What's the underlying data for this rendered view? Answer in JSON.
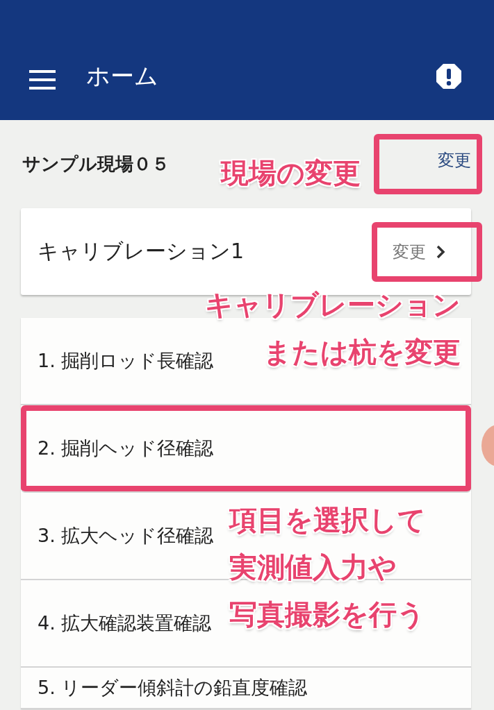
{
  "app_bar": {
    "title": "ホーム"
  },
  "site": {
    "name": "サンプル現場０５",
    "change_label": "変更"
  },
  "calibration": {
    "name": "キャリブレーション1",
    "change_label": "変更"
  },
  "items": [
    {
      "label": "1. 掘削ロッド長確認",
      "selected": false
    },
    {
      "label": "2. 掘削ヘッド径確認",
      "selected": true
    },
    {
      "label": "3. 拡大ヘッド径確認",
      "selected": false
    },
    {
      "label": "4. 拡大確認装置確認",
      "selected": false
    },
    {
      "label": "5. リーダー傾斜計の鉛直度確認",
      "selected": false
    }
  ],
  "annotations": [
    {
      "lines": [
        "現場の変更"
      ]
    },
    {
      "lines": [
        "キャリブレーション",
        "または杭を変更"
      ]
    },
    {
      "lines": [
        "項目を選択して",
        "実測値入力や",
        "写真撮影を行う"
      ]
    }
  ]
}
